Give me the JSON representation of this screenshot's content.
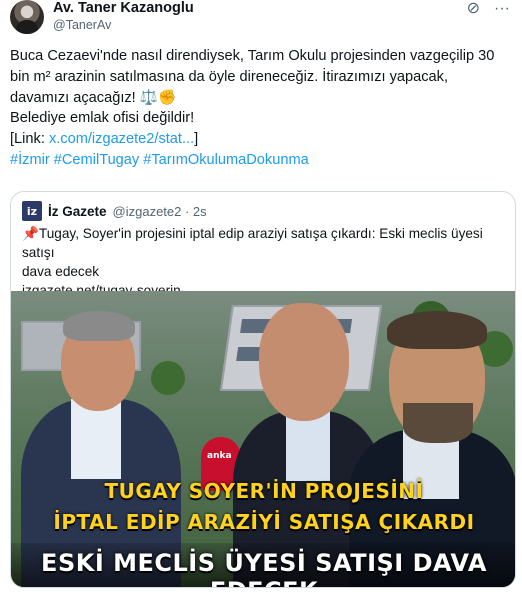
{
  "author": {
    "display_name": "Av. Taner Kazanoglu",
    "handle": "@TanerAv"
  },
  "icons": {
    "top_right": [
      "grok-icon",
      "more-icon"
    ]
  },
  "tweet": {
    "lines": [
      "Buca Cezaevi'nde nasıl direndiysek, Tarım Okulu projesinden vazgeçilip 30",
      "bin m² arazinin satılmasına da öyle direneceğiz. İtirazımızı yapacak,",
      "davamızı açacağız! ⚖️✊",
      "Belediye emlak ofisi değildir!"
    ],
    "link_prefix": "[Link: ",
    "link_text": "x.com/izgazete2/stat...",
    "link_suffix": "]",
    "hashtags": "#İzmir #CemilTugay #TarımOkulumaDokunma"
  },
  "quote": {
    "logo_text": "iz",
    "name": "İz Gazete",
    "handle_time": "@izgazete2 · 2s",
    "text_line1": "📌Tugay, Soyer'in projesini iptal edip araziyi satışa çıkardı: Eski meclis üyesi satışı",
    "text_line2": "dava edecek",
    "url": "izgazete.net/tugay-soyerin-...",
    "image": {
      "mic_label": "anka",
      "headline1": "TUGAY SOYER'İN PROJESİNİ",
      "headline2": "İPTAL EDİP ARAZİYİ SATIŞA ÇIKARDI",
      "headline3": "ESKİ MECLİS ÜYESİ SATIŞI DAVA EDECEK",
      "headline_color": "#ffd21f"
    }
  }
}
